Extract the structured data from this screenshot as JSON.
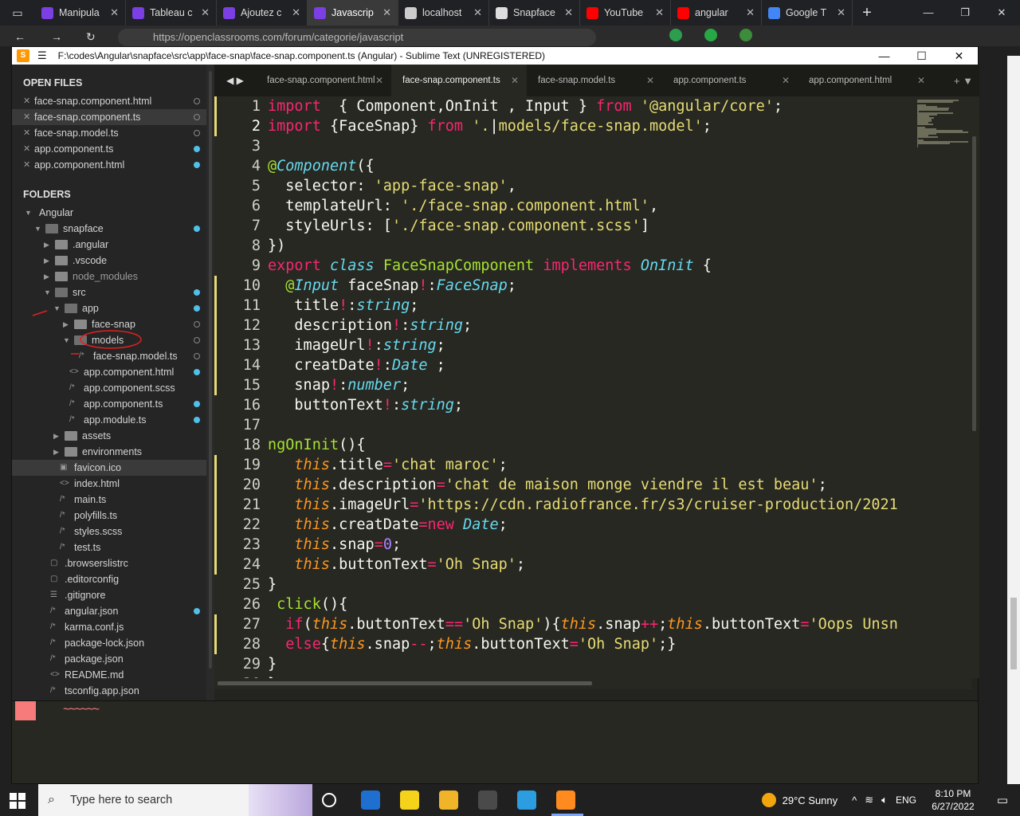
{
  "browser": {
    "tabs": [
      {
        "label": "Manipula",
        "color": "#7b3fe4",
        "active": false
      },
      {
        "label": "Tableau c",
        "color": "#7b3fe4",
        "active": false
      },
      {
        "label": "Ajoutez c",
        "color": "#7b3fe4",
        "active": false
      },
      {
        "label": "Javascrip",
        "color": "#7b3fe4",
        "active": true
      },
      {
        "label": "localhost",
        "color": "#cccccc",
        "active": false
      },
      {
        "label": "Snapface",
        "color": "#dddddd",
        "active": false
      },
      {
        "label": "YouTube",
        "color": "#ff0000",
        "active": false
      },
      {
        "label": "angular ",
        "color": "#ff0000",
        "active": false
      },
      {
        "label": "Google T",
        "color": "#4285f4",
        "active": false
      }
    ],
    "url": "https://openclassrooms.com/forum/categorie/javascript"
  },
  "sublime": {
    "title": "F:\\codes\\Angular\\snapface\\src\\app\\face-snap\\face-snap.component.ts (Angular) - Sublime Text (UNREGISTERED)",
    "logo": "S",
    "open_files_heading": "OPEN FILES",
    "folders_heading": "FOLDERS",
    "open_files": [
      {
        "name": "face-snap.component.html",
        "selected": false,
        "status": "clean"
      },
      {
        "name": "face-snap.component.ts",
        "selected": true,
        "status": "clean"
      },
      {
        "name": "face-snap.model.ts",
        "selected": false,
        "status": "clean"
      },
      {
        "name": "app.component.ts",
        "selected": false,
        "status": "mod"
      },
      {
        "name": "app.component.html",
        "selected": false,
        "status": "mod"
      }
    ],
    "tree": [
      {
        "name": "Angular",
        "kind": "folder-open",
        "depth": 0,
        "status": ""
      },
      {
        "name": "snapface",
        "kind": "folder-open",
        "depth": 1,
        "status": "mod"
      },
      {
        "name": ".angular",
        "kind": "folder",
        "depth": 2,
        "status": ""
      },
      {
        "name": ".vscode",
        "kind": "folder",
        "depth": 2,
        "status": ""
      },
      {
        "name": "node_modules",
        "kind": "folder",
        "depth": 2,
        "status": "",
        "dim": true
      },
      {
        "name": "src",
        "kind": "folder-open",
        "depth": 2,
        "status": "mod"
      },
      {
        "name": "app",
        "kind": "folder-open",
        "depth": 3,
        "status": "mod"
      },
      {
        "name": "face-snap",
        "kind": "folder",
        "depth": 4,
        "status": "clean"
      },
      {
        "name": "models",
        "kind": "folder-open",
        "depth": 4,
        "status": "clean",
        "circled": true
      },
      {
        "name": "face-snap.model.ts",
        "kind": "file",
        "depth": 5,
        "status": "clean",
        "glyph": "/*"
      },
      {
        "name": "app.component.html",
        "kind": "file",
        "depth": 4,
        "status": "mod",
        "glyph": "<>"
      },
      {
        "name": "app.component.scss",
        "kind": "file",
        "depth": 4,
        "status": "",
        "glyph": "/*"
      },
      {
        "name": "app.component.ts",
        "kind": "file",
        "depth": 4,
        "status": "mod",
        "glyph": "/*"
      },
      {
        "name": "app.module.ts",
        "kind": "file",
        "depth": 4,
        "status": "mod",
        "glyph": "/*"
      },
      {
        "name": "assets",
        "kind": "folder",
        "depth": 3,
        "status": ""
      },
      {
        "name": "environments",
        "kind": "folder",
        "depth": 3,
        "status": ""
      },
      {
        "name": "favicon.ico",
        "kind": "file",
        "depth": 3,
        "status": "",
        "glyph": "▣",
        "hover": true
      },
      {
        "name": "index.html",
        "kind": "file",
        "depth": 3,
        "status": "",
        "glyph": "<>"
      },
      {
        "name": "main.ts",
        "kind": "file",
        "depth": 3,
        "status": "",
        "glyph": "/*"
      },
      {
        "name": "polyfills.ts",
        "kind": "file",
        "depth": 3,
        "status": "",
        "glyph": "/*"
      },
      {
        "name": "styles.scss",
        "kind": "file",
        "depth": 3,
        "status": "",
        "glyph": "/*"
      },
      {
        "name": "test.ts",
        "kind": "file",
        "depth": 3,
        "status": "",
        "glyph": "/*"
      },
      {
        "name": ".browserslistrc",
        "kind": "file",
        "depth": 2,
        "status": "",
        "glyph": "▢"
      },
      {
        "name": ".editorconfig",
        "kind": "file",
        "depth": 2,
        "status": "",
        "glyph": "▢"
      },
      {
        "name": ".gitignore",
        "kind": "file",
        "depth": 2,
        "status": "",
        "glyph": "☰"
      },
      {
        "name": "angular.json",
        "kind": "file",
        "depth": 2,
        "status": "mod",
        "glyph": "/*"
      },
      {
        "name": "karma.conf.js",
        "kind": "file",
        "depth": 2,
        "status": "",
        "glyph": "/*"
      },
      {
        "name": "package-lock.json",
        "kind": "file",
        "depth": 2,
        "status": "",
        "glyph": "/*"
      },
      {
        "name": "package.json",
        "kind": "file",
        "depth": 2,
        "status": "",
        "glyph": "/*"
      },
      {
        "name": "README.md",
        "kind": "file",
        "depth": 2,
        "status": "",
        "glyph": "<>"
      },
      {
        "name": "tsconfig.app.json",
        "kind": "file",
        "depth": 2,
        "status": "",
        "glyph": "/*"
      }
    ],
    "editor_tabs": [
      {
        "label": "face-snap.component.html",
        "active": false
      },
      {
        "label": "face-snap.component.ts",
        "active": true
      },
      {
        "label": "face-snap.model.ts",
        "active": false
      },
      {
        "label": "app.component.ts",
        "active": false
      },
      {
        "label": "app.component.html",
        "active": false
      }
    ],
    "code_lines": [
      {
        "n": "1",
        "mark": true,
        "parts": [
          [
            "kw",
            "import"
          ],
          [
            "",
            "  { Component,OnInit , Input } "
          ],
          [
            "kw",
            "from"
          ],
          [
            "",
            " "
          ],
          [
            "st",
            "'@angular/core'"
          ],
          [
            "",
            ";"
          ]
        ]
      },
      {
        "n": "2",
        "mark": true,
        "current": true,
        "parts": [
          [
            "kw",
            "import"
          ],
          [
            "",
            " {FaceSnap} "
          ],
          [
            "kw",
            "from"
          ],
          [
            "",
            " "
          ],
          [
            "st",
            "'."
          ],
          [
            "cr",
            "|"
          ],
          [
            "st",
            "models/face-snap.model'"
          ],
          [
            "",
            ";"
          ]
        ]
      },
      {
        "n": "3",
        "mark": false,
        "parts": []
      },
      {
        "n": "4",
        "mark": false,
        "parts": [
          [
            "dc",
            "@"
          ],
          [
            "ty",
            "Component"
          ],
          [
            "",
            "({"
          ]
        ]
      },
      {
        "n": "5",
        "mark": false,
        "parts": [
          [
            "",
            "  selector: "
          ],
          [
            "st",
            "'app-face-snap'"
          ],
          [
            "",
            ","
          ]
        ]
      },
      {
        "n": "6",
        "mark": false,
        "parts": [
          [
            "",
            "  templateUrl: "
          ],
          [
            "st",
            "'./face-snap.component.html'"
          ],
          [
            "",
            ","
          ]
        ]
      },
      {
        "n": "7",
        "mark": false,
        "parts": [
          [
            "",
            "  styleUrls: ["
          ],
          [
            "st",
            "'./face-snap.component.scss'"
          ],
          [
            "",
            "]"
          ]
        ]
      },
      {
        "n": "8",
        "mark": false,
        "parts": [
          [
            "",
            "})"
          ]
        ]
      },
      {
        "n": "9",
        "mark": false,
        "parts": [
          [
            "kw",
            "export"
          ],
          [
            "",
            " "
          ],
          [
            "ty",
            "class"
          ],
          [
            "",
            " "
          ],
          [
            "fn",
            "FaceSnapComponent"
          ],
          [
            "",
            " "
          ],
          [
            "kw",
            "implements"
          ],
          [
            "",
            " "
          ],
          [
            "ty",
            "OnInit"
          ],
          [
            "",
            " {"
          ]
        ]
      },
      {
        "n": "10",
        "mark": true,
        "parts": [
          [
            "",
            "  "
          ],
          [
            "dc",
            "@"
          ],
          [
            "ty",
            "Input"
          ],
          [
            "",
            " faceSnap"
          ],
          [
            "kw",
            "!"
          ],
          [
            "",
            ":"
          ],
          [
            "ty",
            "FaceSnap"
          ],
          [
            "",
            ";"
          ]
        ]
      },
      {
        "n": "11",
        "mark": true,
        "parts": [
          [
            "",
            "   title"
          ],
          [
            "kw",
            "!"
          ],
          [
            "",
            ":"
          ],
          [
            "ty",
            "string"
          ],
          [
            "",
            ";"
          ]
        ]
      },
      {
        "n": "12",
        "mark": true,
        "parts": [
          [
            "",
            "   description"
          ],
          [
            "kw",
            "!"
          ],
          [
            "",
            ":"
          ],
          [
            "ty",
            "string"
          ],
          [
            "",
            ";"
          ]
        ]
      },
      {
        "n": "13",
        "mark": true,
        "parts": [
          [
            "",
            "   imageUrl"
          ],
          [
            "kw",
            "!"
          ],
          [
            "",
            ":"
          ],
          [
            "ty",
            "string"
          ],
          [
            "",
            ";"
          ]
        ]
      },
      {
        "n": "14",
        "mark": true,
        "parts": [
          [
            "",
            "   creatDate"
          ],
          [
            "kw",
            "!"
          ],
          [
            "",
            ":"
          ],
          [
            "ty",
            "Date"
          ],
          [
            "",
            " ;"
          ]
        ]
      },
      {
        "n": "15",
        "mark": true,
        "parts": [
          [
            "",
            "   snap"
          ],
          [
            "kw",
            "!"
          ],
          [
            "",
            ":"
          ],
          [
            "ty",
            "number"
          ],
          [
            "",
            ";"
          ]
        ]
      },
      {
        "n": "16",
        "mark": false,
        "parts": [
          [
            "",
            "   buttonText"
          ],
          [
            "kw",
            "!"
          ],
          [
            "",
            ":"
          ],
          [
            "ty",
            "string"
          ],
          [
            "",
            ";"
          ]
        ]
      },
      {
        "n": "17",
        "mark": false,
        "parts": []
      },
      {
        "n": "18",
        "mark": false,
        "parts": [
          [
            "fn",
            "ngOnInit"
          ],
          [
            "",
            "(){"
          ]
        ]
      },
      {
        "n": "19",
        "mark": true,
        "parts": [
          [
            "",
            "   "
          ],
          [
            "th",
            "this"
          ],
          [
            "",
            ".title"
          ],
          [
            "kw",
            "="
          ],
          [
            "st",
            "'chat maroc'"
          ],
          [
            "",
            ";"
          ]
        ]
      },
      {
        "n": "20",
        "mark": true,
        "parts": [
          [
            "",
            "   "
          ],
          [
            "th",
            "this"
          ],
          [
            "",
            ".description"
          ],
          [
            "kw",
            "="
          ],
          [
            "st",
            "'chat de maison monge viendre il est beau'"
          ],
          [
            "",
            ";"
          ]
        ]
      },
      {
        "n": "21",
        "mark": true,
        "parts": [
          [
            "",
            "   "
          ],
          [
            "th",
            "this"
          ],
          [
            "",
            ".imageUrl"
          ],
          [
            "kw",
            "="
          ],
          [
            "st",
            "'https://cdn.radiofrance.fr/s3/cruiser-production/2021"
          ]
        ]
      },
      {
        "n": "22",
        "mark": true,
        "parts": [
          [
            "",
            "   "
          ],
          [
            "th",
            "this"
          ],
          [
            "",
            ".creatDate"
          ],
          [
            "kw",
            "="
          ],
          [
            "kw",
            "new"
          ],
          [
            "",
            " "
          ],
          [
            "ty",
            "Date"
          ],
          [
            "",
            ";"
          ]
        ]
      },
      {
        "n": "23",
        "mark": true,
        "parts": [
          [
            "",
            "   "
          ],
          [
            "th",
            "this"
          ],
          [
            "",
            ".snap"
          ],
          [
            "kw",
            "="
          ],
          [
            "nu",
            "0"
          ],
          [
            "",
            ";"
          ]
        ]
      },
      {
        "n": "24",
        "mark": true,
        "parts": [
          [
            "",
            "   "
          ],
          [
            "th",
            "this"
          ],
          [
            "",
            ".buttonText"
          ],
          [
            "kw",
            "="
          ],
          [
            "st",
            "'Oh Snap'"
          ],
          [
            "",
            ";"
          ]
        ]
      },
      {
        "n": "25",
        "mark": false,
        "parts": [
          [
            "",
            "}"
          ]
        ]
      },
      {
        "n": "26",
        "mark": false,
        "parts": [
          [
            "",
            " "
          ],
          [
            "fn",
            "click"
          ],
          [
            "",
            "(){"
          ]
        ]
      },
      {
        "n": "27",
        "mark": true,
        "parts": [
          [
            "",
            "  "
          ],
          [
            "kw",
            "if"
          ],
          [
            "",
            "("
          ],
          [
            "th",
            "this"
          ],
          [
            "",
            ".buttonText"
          ],
          [
            "kw",
            "=="
          ],
          [
            "st",
            "'Oh Snap'"
          ],
          [
            "",
            "){"
          ],
          [
            "th",
            "this"
          ],
          [
            "",
            ".snap"
          ],
          [
            "kw",
            "++"
          ],
          [
            "",
            ";"
          ],
          [
            "th",
            "this"
          ],
          [
            "",
            ".buttonText"
          ],
          [
            "kw",
            "="
          ],
          [
            "st",
            "'Oops Unsn"
          ]
        ]
      },
      {
        "n": "28",
        "mark": true,
        "parts": [
          [
            "",
            "  "
          ],
          [
            "kw",
            "else"
          ],
          [
            "",
            "{"
          ],
          [
            "th",
            "this"
          ],
          [
            "",
            ".snap"
          ],
          [
            "kw",
            "--"
          ],
          [
            "",
            ";"
          ],
          [
            "th",
            "this"
          ],
          [
            "",
            ".buttonText"
          ],
          [
            "kw",
            "="
          ],
          [
            "st",
            "'Oh Snap'"
          ],
          [
            "",
            ";}"
          ]
        ]
      },
      {
        "n": "29",
        "mark": false,
        "parts": [
          [
            "",
            "}"
          ]
        ]
      },
      {
        "n": "30",
        "mark": false,
        "parts": [
          [
            "",
            "}"
          ]
        ]
      }
    ]
  },
  "taskbar": {
    "search_placeholder": "Type here to search",
    "weather": "29°C  Sunny",
    "language": "ENG",
    "time": "8:10 PM",
    "date": "6/27/2022",
    "icons": [
      {
        "name": "task-view-icon",
        "color": "transparent"
      },
      {
        "name": "mail-icon",
        "color": "#1f6fd1"
      },
      {
        "name": "sticky-notes-icon",
        "color": "#f5d31a"
      },
      {
        "name": "file-explorer-icon",
        "color": "#f0b429"
      },
      {
        "name": "store-icon",
        "color": "#4a4a4a"
      },
      {
        "name": "edge-icon",
        "color": "#2b9de0"
      },
      {
        "name": "sublime-text-icon",
        "color": "#ff8a1f"
      }
    ]
  }
}
